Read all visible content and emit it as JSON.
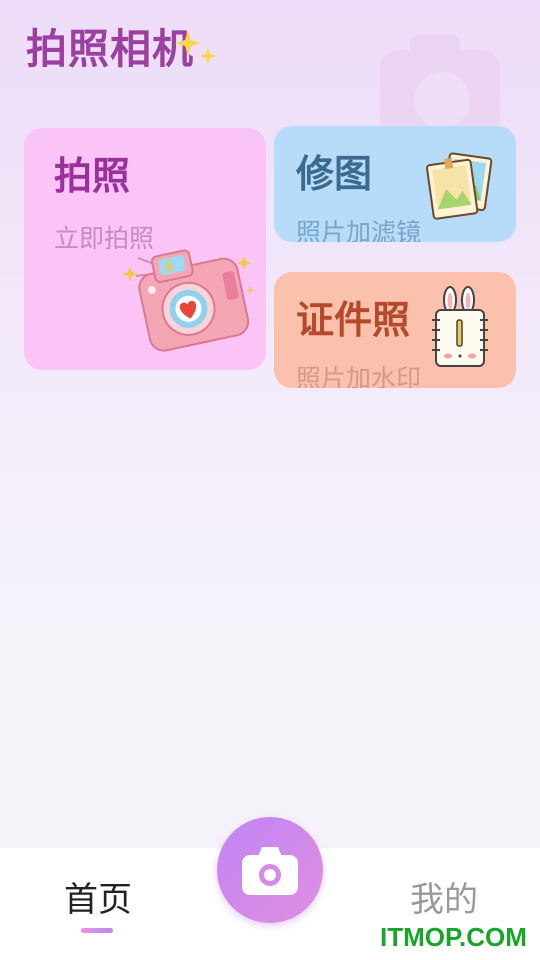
{
  "header": {
    "app_title": "拍照相机"
  },
  "cards": {
    "photo": {
      "title": "拍照",
      "subtitle": "立即拍照",
      "color": "#fac4f6"
    },
    "edit": {
      "title": "修图",
      "subtitle": "照片加滤镜",
      "color": "#b6dcfa"
    },
    "id": {
      "title": "证件照",
      "subtitle": "照片加水印",
      "color": "#fcc1ac"
    }
  },
  "tabbar": {
    "home_label": "首页",
    "mine_label": "我的",
    "center_icon": "camera-icon",
    "accent": "#c084f5"
  },
  "watermark": "ITMOP.COM"
}
